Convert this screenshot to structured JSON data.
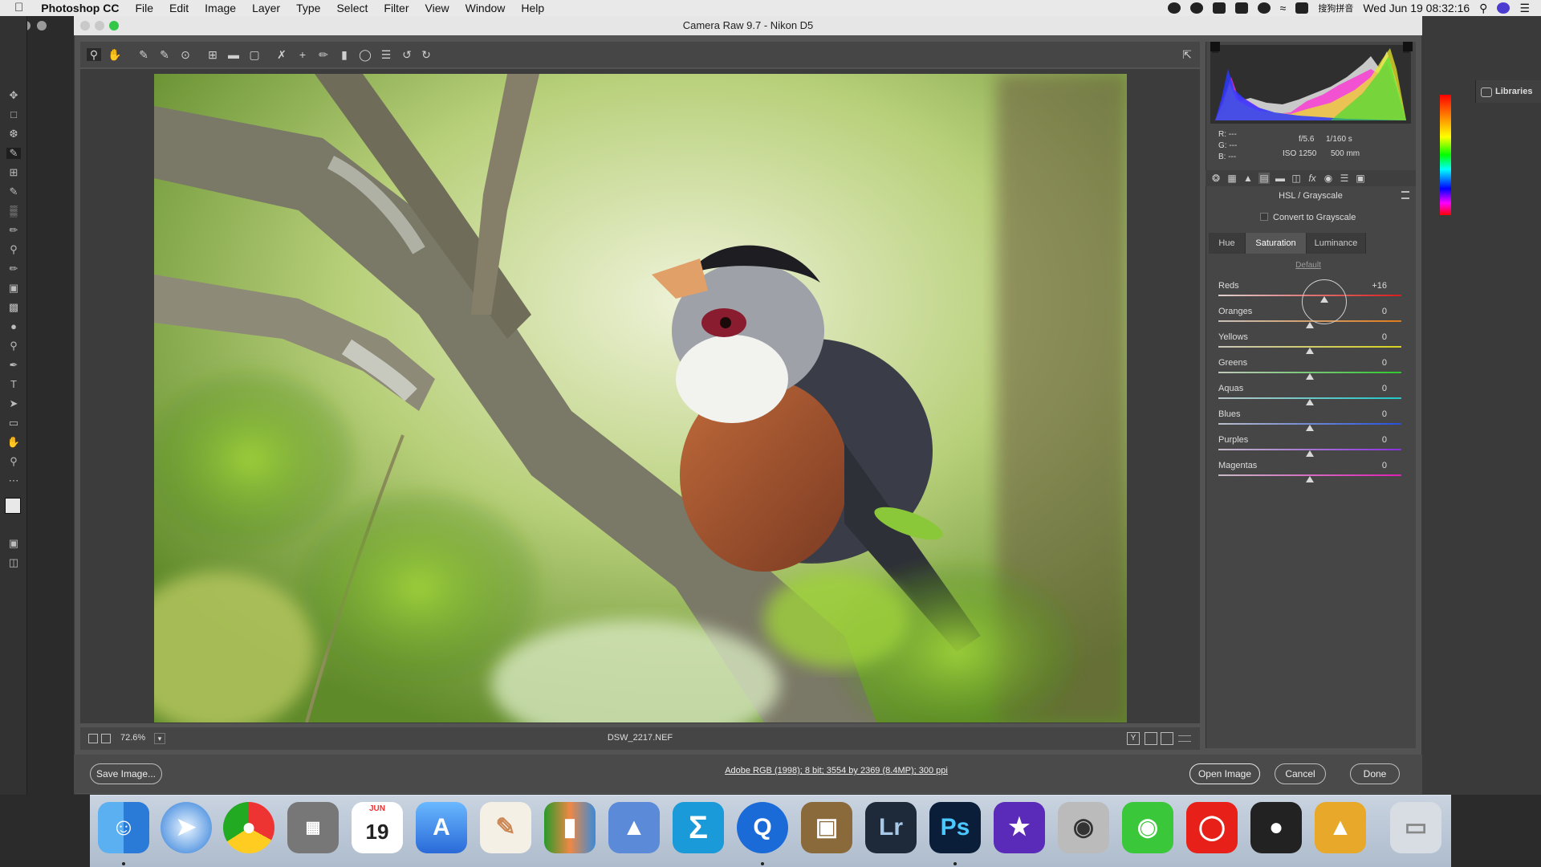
{
  "menubar": {
    "app": "Photoshop CC",
    "items": [
      "File",
      "Edit",
      "Image",
      "Layer",
      "Type",
      "Select",
      "Filter",
      "View",
      "Window",
      "Help"
    ],
    "ime": "搜狗拼音",
    "clock": "Wed Jun 19  08:32:16"
  },
  "dialog": {
    "title": "Camera Raw 9.7  -  Nikon D5",
    "filename": "DSW_2217.NEF",
    "zoom": "72.6%",
    "info_link": "Adobe RGB (1998); 8 bit; 3554 by 2369 (8.4MP); 300 ppi",
    "save_label": "Save Image...",
    "open_label": "Open Image",
    "cancel_label": "Cancel",
    "done_label": "Done"
  },
  "camera": {
    "r": "R:   ---",
    "g": "G:   ---",
    "b": "B:   ---",
    "aperture": "f/5.6",
    "shutter": "1/160 s",
    "iso": "ISO 1250",
    "focal": "500 mm"
  },
  "hsl": {
    "title": "HSL / Grayscale",
    "convert_label": "Convert to Grayscale",
    "tabs": [
      "Hue",
      "Saturation",
      "Luminance"
    ],
    "active_tab": "Saturation",
    "default_label": "Default",
    "sliders": [
      {
        "name": "Reds",
        "value": "+16",
        "amount": 16,
        "from": "#e0d0d0",
        "to": "#d91c1c"
      },
      {
        "name": "Oranges",
        "value": "0",
        "amount": 0,
        "from": "#c8c2bc",
        "to": "#e07a18"
      },
      {
        "name": "Yellows",
        "value": "0",
        "amount": 0,
        "from": "#c8c6bc",
        "to": "#d8d21c"
      },
      {
        "name": "Greens",
        "value": "0",
        "amount": 0,
        "from": "#c0c8bc",
        "to": "#2ec82e"
      },
      {
        "name": "Aquas",
        "value": "0",
        "amount": 0,
        "from": "#bcc6c6",
        "to": "#1cc8c8"
      },
      {
        "name": "Blues",
        "value": "0",
        "amount": 0,
        "from": "#bcbfc8",
        "to": "#2450e0"
      },
      {
        "name": "Purples",
        "value": "0",
        "amount": 0,
        "from": "#c2bcc8",
        "to": "#8a2ee0"
      },
      {
        "name": "Magentas",
        "value": "0",
        "amount": 0,
        "from": "#c8bcc6",
        "to": "#e01cb8"
      }
    ]
  },
  "ps_panel": {
    "libraries": "Libraries"
  },
  "dock": {
    "calendar_month": "JUN",
    "calendar_day": "19",
    "lr": "Lr",
    "ps": "Ps"
  }
}
